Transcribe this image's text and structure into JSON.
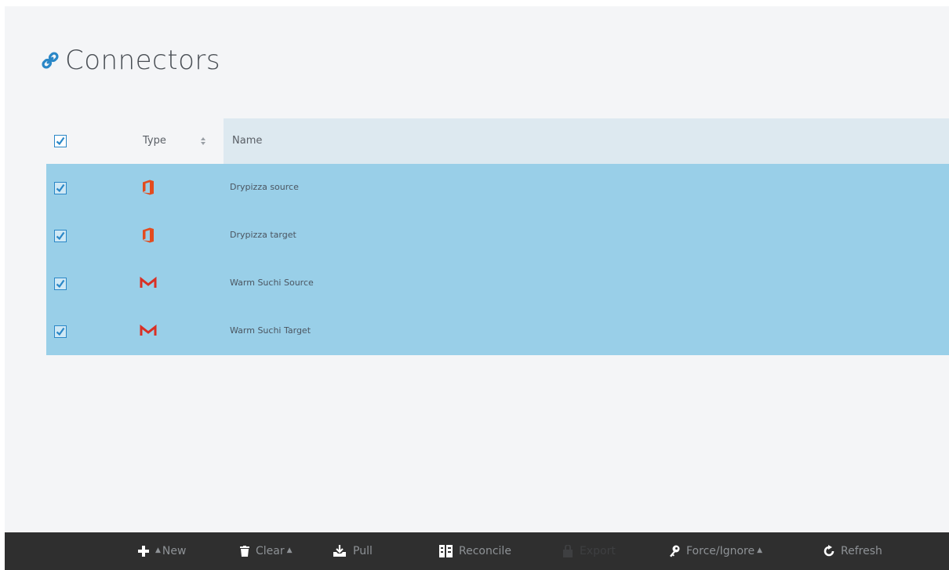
{
  "page": {
    "title": "Connectors",
    "title_icon": "link-icon",
    "accent_color": "#2a87c7"
  },
  "grid": {
    "columns": {
      "type": "Type",
      "name": "Name"
    },
    "header_checked": true,
    "rows": [
      {
        "checked": true,
        "type_icon": "office-icon",
        "name": "Drypizza source"
      },
      {
        "checked": true,
        "type_icon": "office-icon",
        "name": "Drypizza target"
      },
      {
        "checked": true,
        "type_icon": "gmail-icon",
        "name": "Warm Suchi Source"
      },
      {
        "checked": true,
        "type_icon": "gmail-icon",
        "name": "Warm Suchi Target"
      }
    ],
    "selected_row_color": "#99cfe8"
  },
  "toolbar": {
    "new_label": "New",
    "clear_label": "Clear",
    "pull_label": "Pull",
    "reconcile_label": "Reconcile",
    "export_label": "Export",
    "force_ignore_label": "Force/Ignore",
    "refresh_label": "Refresh"
  }
}
